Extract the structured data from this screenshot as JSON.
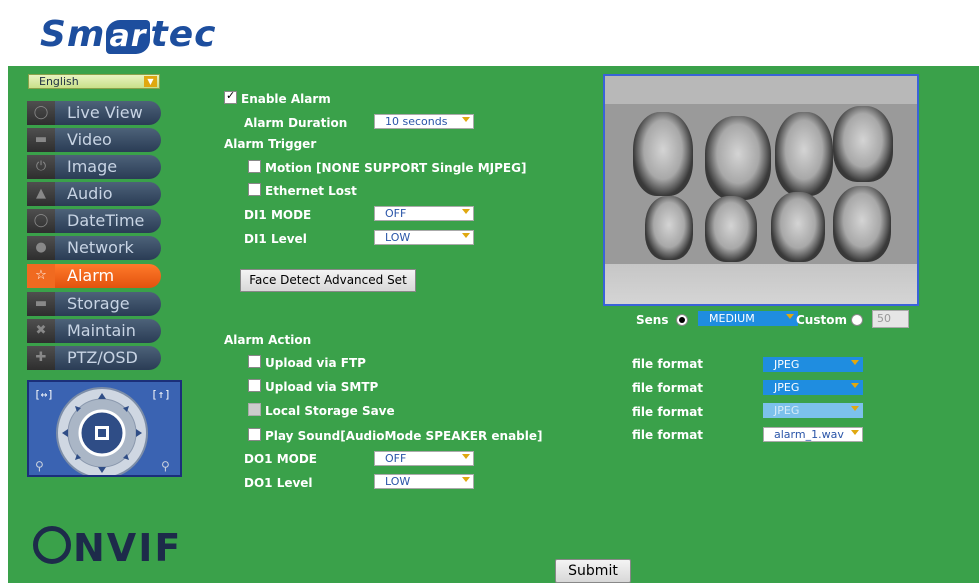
{
  "brand": {
    "logo_left": "Sm",
    "logo_mid": "ar",
    "logo_right": "tec"
  },
  "language": {
    "selected": "English"
  },
  "nav": [
    {
      "label": "Live View",
      "icon": "chat-icon"
    },
    {
      "label": "Video",
      "icon": "video-icon"
    },
    {
      "label": "Image",
      "icon": "power-icon"
    },
    {
      "label": "Audio",
      "icon": "speaker-icon"
    },
    {
      "label": "DateTime",
      "icon": "clock-icon"
    },
    {
      "label": "Network",
      "icon": "globe-icon"
    },
    {
      "label": "Alarm",
      "icon": "star-icon",
      "active": true
    },
    {
      "label": "Storage",
      "icon": "disk-icon"
    },
    {
      "label": "Maintain",
      "icon": "tools-icon"
    },
    {
      "label": "PTZ/OSD",
      "icon": "ptz-icon"
    }
  ],
  "onvif": "NVIF",
  "alarm": {
    "enable_label": "Enable Alarm",
    "duration_label": "Alarm Duration",
    "duration_value": "10 seconds",
    "trigger_label": "Alarm Trigger",
    "motion_label": "Motion [NONE SUPPORT Single MJPEG]",
    "ethernet_label": "Ethernet Lost",
    "di1_mode_label": "DI1 MODE",
    "di1_mode_value": "OFF",
    "di1_level_label": "DI1 Level",
    "di1_level_value": "LOW",
    "face_button": "Face Detect Advanced Set",
    "action_label": "Alarm Action",
    "ftp_label": "Upload via FTP",
    "smtp_label": "Upload via SMTP",
    "local_label": "Local Storage Save",
    "sound_label": "Play Sound[AudioMode SPEAKER enable]",
    "do1_mode_label": "DO1 MODE",
    "do1_mode_value": "OFF",
    "do1_level_label": "DO1 Level",
    "do1_level_value": "LOW"
  },
  "file_formats": [
    {
      "label": "file format",
      "value": "JPEG"
    },
    {
      "label": "file format",
      "value": "JPEG"
    },
    {
      "label": "file format",
      "value": "JPEG"
    },
    {
      "label": "file format",
      "value": "alarm_1.wav"
    }
  ],
  "sens": {
    "label": "Sens",
    "value": "MEDIUM",
    "custom_label": "Custom",
    "custom_value": "50"
  },
  "submit": "Submit"
}
